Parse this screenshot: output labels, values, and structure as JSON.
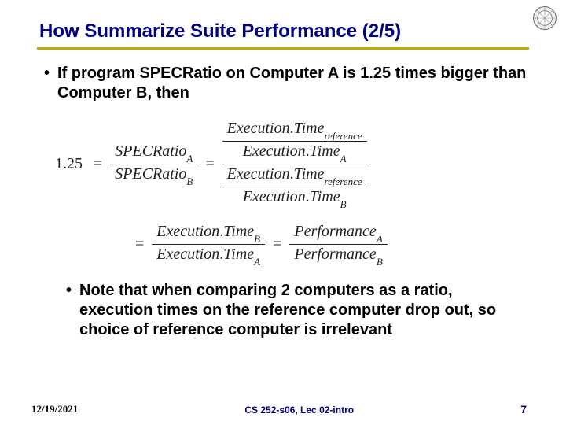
{
  "title": "How Summarize Suite Performance (2/5)",
  "bullets": {
    "b1": "If program SPECRatio on Computer A is 1.25 times bigger than Computer B, then",
    "b2": "Note that when comparing 2 computers as a ratio, execution times on the reference computer drop out, so choice of reference computer is irrelevant"
  },
  "eq": {
    "const": "1.25",
    "specA": "SPECRatio",
    "specB": "SPECRatio",
    "subA": "A",
    "subB": "B",
    "execTime": "Execution",
    "dot": ".",
    "time": "Time",
    "ref": "reference",
    "perf": "Performance"
  },
  "footer": {
    "date": "12/19/2021",
    "course": "CS 252-s06, Lec 02-intro",
    "page": "7"
  }
}
